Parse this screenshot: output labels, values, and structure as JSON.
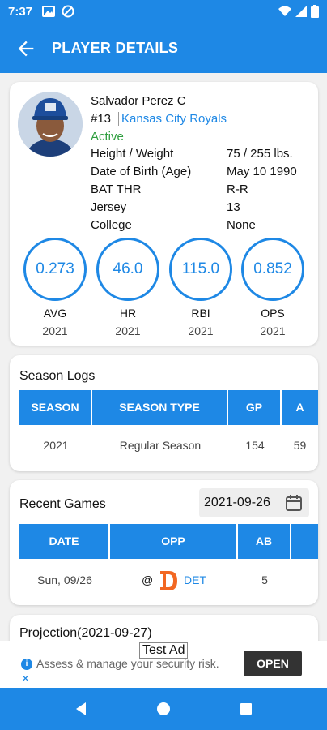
{
  "status_bar": {
    "time": "7:37"
  },
  "app_bar": {
    "title": "PLAYER DETAILS"
  },
  "player": {
    "name": "Salvador Perez C",
    "number": "#13",
    "team": "Kansas City Royals",
    "status": "Active",
    "info": [
      {
        "label": "Height / Weight",
        "value": "75 / 255 lbs."
      },
      {
        "label": "Date of Birth (Age)",
        "value": "May 10 1990"
      },
      {
        "label": "BAT THR",
        "value": "R-R"
      },
      {
        "label": "Jersey",
        "value": "13"
      },
      {
        "label": "College",
        "value": "None"
      }
    ]
  },
  "stats": [
    {
      "value": "0.273",
      "label": "AVG",
      "year": "2021"
    },
    {
      "value": "46.0",
      "label": "HR",
      "year": "2021"
    },
    {
      "value": "115.0",
      "label": "RBI",
      "year": "2021"
    },
    {
      "value": "0.852",
      "label": "OPS",
      "year": "2021"
    }
  ],
  "season_logs": {
    "title": "Season Logs",
    "columns": [
      "SEASON",
      "SEASON TYPE",
      "GP",
      "A"
    ],
    "rows": [
      [
        "2021",
        "Regular Season",
        "154",
        "59"
      ]
    ]
  },
  "recent_games": {
    "title": "Recent Games",
    "date": "2021-09-26",
    "columns": [
      "DATE",
      "OPP",
      "AB",
      ""
    ],
    "rows": [
      {
        "date": "Sun, 09/26",
        "at": "@",
        "opp": "DET",
        "ab": "5"
      }
    ]
  },
  "projection": {
    "title": "Projection(2021-09-27)"
  },
  "ad": {
    "label": "Test Ad",
    "text": "Assess & manage your security risk.",
    "button": "OPEN"
  },
  "colors": {
    "primary": "#1e88e5",
    "active": "#2e9e3e",
    "tigers_orange": "#f26722"
  }
}
